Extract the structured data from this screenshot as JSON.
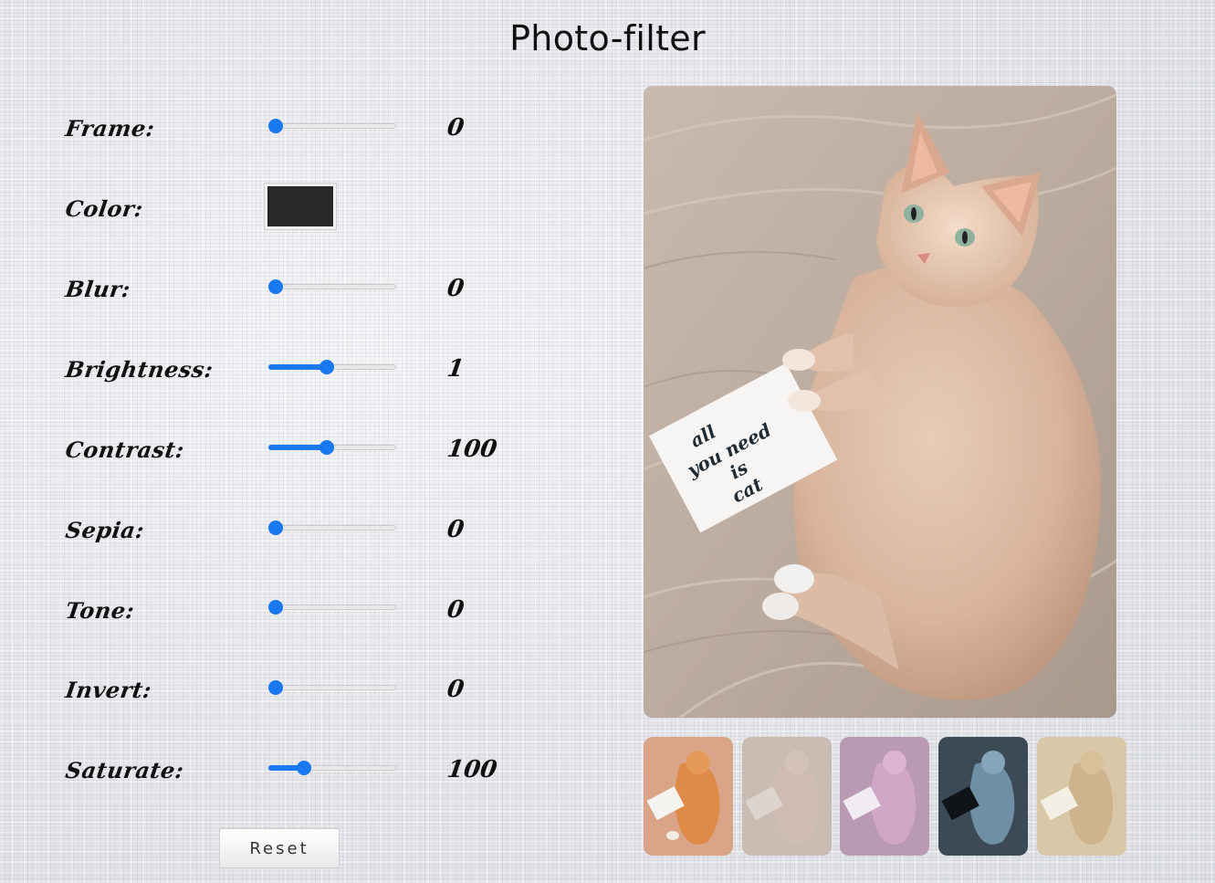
{
  "title": "Photo-filter",
  "controls": [
    {
      "id": "frame",
      "label": "Frame:",
      "value": "0",
      "fraction": 0.0
    },
    {
      "id": "color",
      "label": "Color:",
      "swatch": "#282828"
    },
    {
      "id": "blur",
      "label": "Blur:",
      "value": "0",
      "fraction": 0.0
    },
    {
      "id": "brightness",
      "label": "Brightness:",
      "value": "1",
      "fraction": 0.5
    },
    {
      "id": "contrast",
      "label": "Contrast:",
      "value": "100",
      "fraction": 0.5
    },
    {
      "id": "sepia",
      "label": "Sepia:",
      "value": "0",
      "fraction": 0.0
    },
    {
      "id": "tone",
      "label": "Tone:",
      "value": "0",
      "fraction": 0.0
    },
    {
      "id": "invert",
      "label": "Invert:",
      "value": "0",
      "fraction": 0.0
    },
    {
      "id": "saturate",
      "label": "Saturate:",
      "value": "100",
      "fraction": 0.33
    }
  ],
  "reset_label": "Reset",
  "photo": {
    "card_lines": [
      "all",
      "you need",
      "is",
      "cat"
    ]
  },
  "presets": [
    "orange-warm",
    "blurred",
    "purple-tint",
    "inverted-blue",
    "sepia"
  ],
  "colors": {
    "accent": "#1a78f0",
    "swatch": "#282828"
  }
}
